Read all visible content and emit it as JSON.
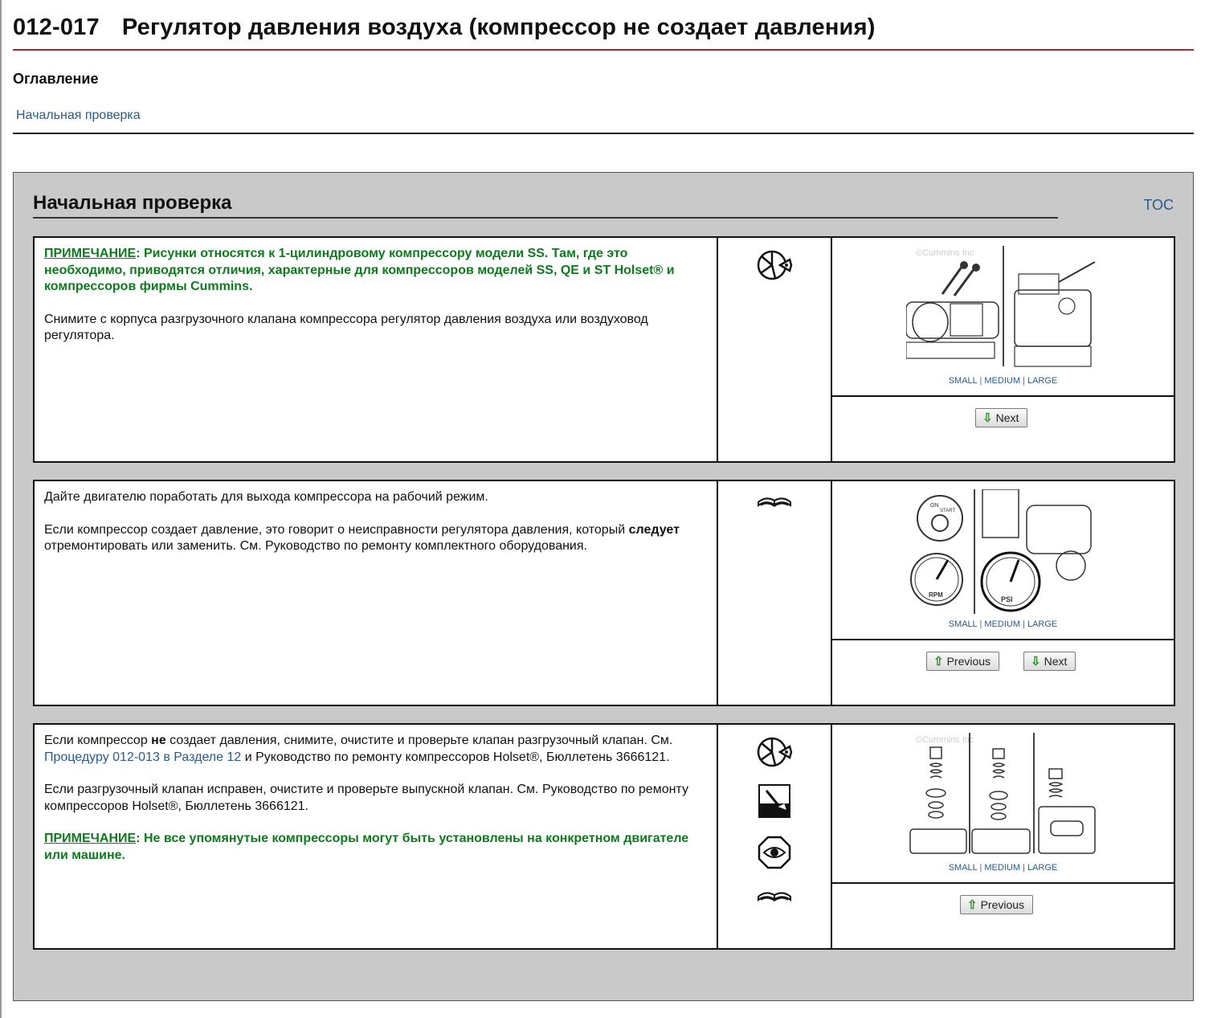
{
  "page": {
    "code": "012-017",
    "title": "Регулятор давления воздуха (компрессор не создает давления)"
  },
  "toc": {
    "heading": "Оглавление",
    "link": "Начальная проверка"
  },
  "section": {
    "title": "Начальная проверка",
    "toc_link": "TOC"
  },
  "size_links": {
    "small": "SMALL",
    "medium": "MEDIUM",
    "large": "LARGE",
    "sep": "|"
  },
  "buttons": {
    "next": "Next",
    "previous": "Previous"
  },
  "watermark": "©Cummins Inc",
  "steps": [
    {
      "note_label": "ПРИМЕЧАНИЕ",
      "note_text": ": Рисунки относятся к 1-цилиндровому компрессору модели SS. Там, где это необходимо, приводятся отличия, характерные для компрессоров моделей SS, QE и ST Holset® и компрессоров фирмы Cummins.",
      "text1": "Снимите с корпуса разгрузочного клапана компрессора регулятор давления воздуха или воздуховод регулятора.",
      "icons": [
        "wrench-tool-icon"
      ]
    },
    {
      "text1": "Дайте двигателю поработать для выхода компрессора на рабочий режим.",
      "text2_a": "Если компрессор создает давление, это говорит о неисправности регулятора давления, который ",
      "text2_b": "следует",
      "text2_c": " отремонтировать или заменить. См. Руководство по ремонту комплектного оборудования.",
      "icons": [
        "manual-book-icon"
      ],
      "gauge_labels": {
        "rpm": "RPM",
        "psi": "PSI",
        "on": "ON",
        "start": "START"
      }
    },
    {
      "text1_a": "Если компрессор ",
      "text1_b": "не",
      "text1_c": " создает давления, снимите, очистите и проверьте клапан разгрузочный клапан. См. ",
      "text1_link": "Процедуру 012-013 в Разделе 12",
      "text1_d": " и Руководство по ремонту компрессоров Holset®, Бюллетень 3666121.",
      "text2": "Если разгрузочный клапан исправен, очистите и проверьте выпускной клапан. См. Руководство по ремонту компрессоров Holset®, Бюллетень 3666121.",
      "note_label": "ПРИМЕЧАНИЕ",
      "note_text": ":  Не все упомянутые компрессоры могут быть установлены на конкретном двигателе или машине.",
      "icons": [
        "wrench-tool-icon",
        "cleaning-icon",
        "inspect-eye-icon",
        "manual-book-icon"
      ]
    }
  ]
}
